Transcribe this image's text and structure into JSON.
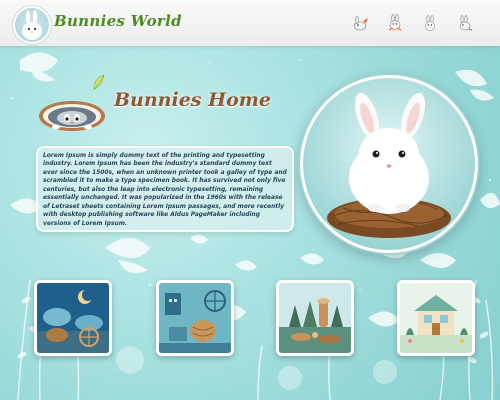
{
  "header": {
    "logo_text": "Bunnies World",
    "nav_icons": [
      "bunny-carrot-icon",
      "bunny-running-icon",
      "bunny-sitting-icon",
      "bunny-hopping-icon"
    ]
  },
  "hero": {
    "title": "Bunnies Home",
    "description": "Lorem Ipsum is simply dummy text of the printing and typesetting industry. Lorem Ipsum has been the industry's standard dummy text ever since the 1500s, when an unknown printer took a galley of type and scrambled it to make a type specimen book. It has survived not only five centuries, but also the leap into electronic typesetting, remaining essentially unchanged. It was popularized in the 1960s with the release of Letraset sheets containing Lorem Ipsum passages, and more recently with desktop publishing software like Aldus PageMaker including versions of Lorem Ipsum."
  },
  "gallery": {
    "items": [
      "night-crafts-image",
      "tools-crafts-image",
      "forest-miniature-image",
      "cottage-miniature-image"
    ]
  },
  "colors": {
    "background": "#9fdcdc",
    "logo_text": "#4f8a25",
    "title": "#8b5a34",
    "description_text": "#23465a"
  }
}
